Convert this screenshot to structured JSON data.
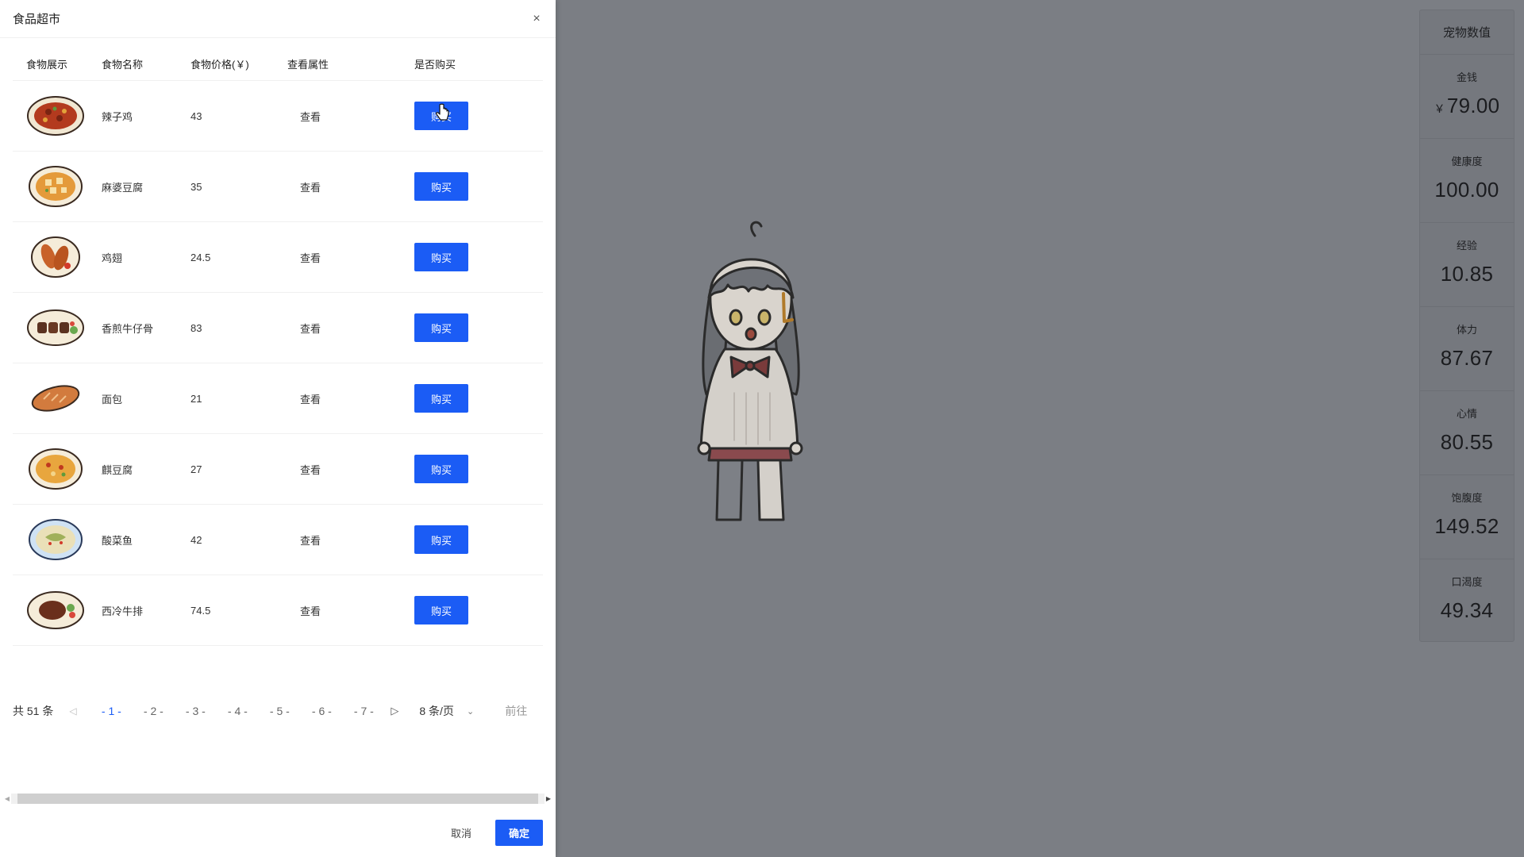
{
  "drawer": {
    "title": "食品超市",
    "close": "×"
  },
  "table": {
    "headers": [
      "食物展示",
      "食物名称",
      "食物价格(￥)",
      "查看属性",
      "是否购买"
    ],
    "rows": [
      {
        "name": "辣子鸡",
        "price": "43",
        "view": "查看",
        "buy": "购买",
        "image": "spicy-chicken-dish"
      },
      {
        "name": "麻婆豆腐",
        "price": "35",
        "view": "查看",
        "buy": "购买",
        "image": "mapo-tofu-dish"
      },
      {
        "name": "鸡翅",
        "price": "24.5",
        "view": "查看",
        "buy": "购买",
        "image": "chicken-wings-dish"
      },
      {
        "name": "香煎牛仔骨",
        "price": "83",
        "view": "查看",
        "buy": "购买",
        "image": "beef-ribs-dish"
      },
      {
        "name": "面包",
        "price": "21",
        "view": "查看",
        "buy": "购买",
        "image": "bread"
      },
      {
        "name": "麒豆腐",
        "price": "27",
        "view": "查看",
        "buy": "购买",
        "image": "tofu-dish"
      },
      {
        "name": "酸菜鱼",
        "price": "42",
        "view": "查看",
        "buy": "购买",
        "image": "pickled-fish-dish"
      },
      {
        "name": "西冷牛排",
        "price": "74.5",
        "view": "查看",
        "buy": "购买",
        "image": "sirloin-steak-dish"
      }
    ]
  },
  "pagination": {
    "total": "共 51 条",
    "pages": [
      "- 1 -",
      "- 2 -",
      "- 3 -",
      "- 4 -",
      "- 5 -",
      "- 6 -",
      "- 7 -"
    ],
    "active_page": 1,
    "page_size": "8 条/页",
    "goto": "前往"
  },
  "footer": {
    "cancel": "取消",
    "ok": "确定"
  },
  "stats": {
    "title": "宠物数值",
    "items": [
      {
        "label": "金钱",
        "currency": "￥",
        "value": "79.00"
      },
      {
        "label": "健康度",
        "currency": "",
        "value": "100.00"
      },
      {
        "label": "经验",
        "currency": "",
        "value": "10.85"
      },
      {
        "label": "体力",
        "currency": "",
        "value": "87.67"
      },
      {
        "label": "心情",
        "currency": "",
        "value": "80.55"
      },
      {
        "label": "饱腹度",
        "currency": "",
        "value": "149.52"
      },
      {
        "label": "口渴度",
        "currency": "",
        "value": "49.34"
      }
    ]
  },
  "colors": {
    "primary": "#1b5cf5",
    "overlay": "#7b7e84"
  }
}
